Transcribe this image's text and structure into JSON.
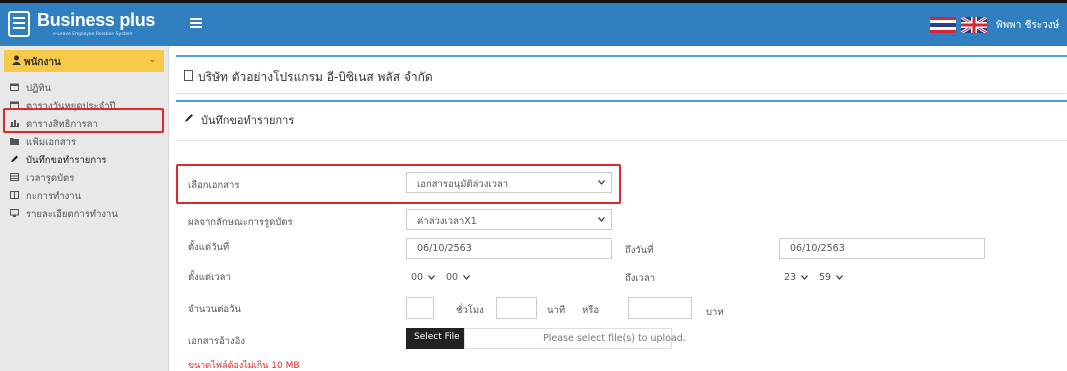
{
  "header": {
    "logo_title": "Business plus",
    "logo_subtitle": "e-Leave Employee Relation System",
    "user_name": "พิพพา ชีระวงษ์",
    "accent_color": "#2f7fc1"
  },
  "sidebar": {
    "section_title": "พนักงาน",
    "items": [
      {
        "label": "ปฏิทิน",
        "icon": "calendar-icon"
      },
      {
        "label": "ตารางวันหยุดประจำปี",
        "icon": "calendar-icon"
      },
      {
        "label": "ตารางสิทธิการลา",
        "icon": "bar-chart-icon"
      },
      {
        "label": "แฟ้มเอกสาร",
        "icon": "folder-icon"
      },
      {
        "label": "บันทึกขอทำรายการ",
        "icon": "pencil-icon"
      },
      {
        "label": "เวลารูดบัตร",
        "icon": "table-icon"
      },
      {
        "label": "กะการทำงาน",
        "icon": "columns-icon"
      },
      {
        "label": "รายละเอียดการทำงาน",
        "icon": "monitor-icon"
      }
    ]
  },
  "company": {
    "title": "บริษัท ตัวอย่างโปรแกรม อี-บิซิเนส พลัส จำกัด"
  },
  "form": {
    "title": "บันทึกขอทำรายการ",
    "doc_label": "เลือกเอกสาร",
    "doc_value": "เอกสารอนุมัติล่วงเวลา",
    "swipe_label": "ผลจากลักษณะการรูดบัตร",
    "swipe_value": "ค่าล่วงเวลาX1",
    "from_date_label": "ตั้งแต่วันที่",
    "from_date_value": "06/10/2563",
    "to_date_label": "ถึงวันที่",
    "to_date_value": "06/10/2563",
    "from_time_label": "ตั้งแต่เวลา",
    "from_hour": "00",
    "from_minute": "00",
    "to_time_label": "ถึงเวลา",
    "to_hour": "23",
    "to_minute": "59",
    "per_day_label": "จำนวนต่อวัน",
    "hours_unit": "ชั่วโมง",
    "minutes_unit": "นาที",
    "or_label": "หรือ",
    "baht_unit": "บาท",
    "ref_doc_label": "เอกสารอ้างอิง",
    "select_file_label": "Select File",
    "file_placeholder": "Please select file(s) to upload.",
    "file_size_note": "ขนาดไฟล์ต้องไม่เกิน 10 MB"
  }
}
